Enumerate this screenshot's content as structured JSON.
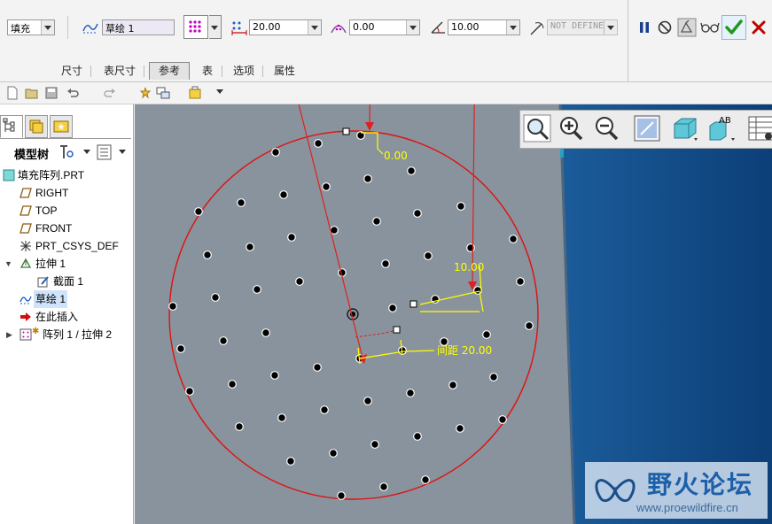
{
  "dashboard": {
    "fill_type": "填充",
    "sketch_ref": "草绘 1",
    "spacing": "20.00",
    "border_offset": "0.00",
    "rotation": "10.00",
    "radial_value": "NOT DEFINE",
    "tabs": [
      "尺寸",
      "表尺寸",
      "参考",
      "表",
      "选项",
      "属性"
    ],
    "active_tab": "参考"
  },
  "left_panel": {
    "title": "模型树",
    "items": [
      {
        "label": "填充阵列.PRT",
        "icon": "part-icon"
      },
      {
        "label": "RIGHT",
        "icon": "datum-plane-icon"
      },
      {
        "label": "TOP",
        "icon": "datum-plane-icon"
      },
      {
        "label": "FRONT",
        "icon": "datum-plane-icon"
      },
      {
        "label": "PRT_CSYS_DEF",
        "icon": "csys-icon"
      },
      {
        "label": "拉伸 1",
        "icon": "extrude-icon"
      },
      {
        "label": "截面 1",
        "icon": "section-icon"
      },
      {
        "label": "草绘 1",
        "icon": "sketch-icon"
      },
      {
        "label": "在此插入",
        "icon": "insert-here-icon"
      },
      {
        "label": "阵列 1 / 拉伸 2",
        "icon": "pattern-icon"
      }
    ]
  },
  "graphics": {
    "dim_offset": "0.00",
    "dim_rotation": "10.00",
    "dim_spacing": "间距 20.00"
  },
  "watermark": {
    "title": "野火论坛",
    "url": "www.proewildfire.cn"
  },
  "colors": {
    "viewport": "#89939d",
    "boundary": "#e01010",
    "dimension": "#ffff00",
    "leader": "#e02020",
    "ok_green": "#1e9a1e",
    "cancel_red": "#c00000"
  }
}
